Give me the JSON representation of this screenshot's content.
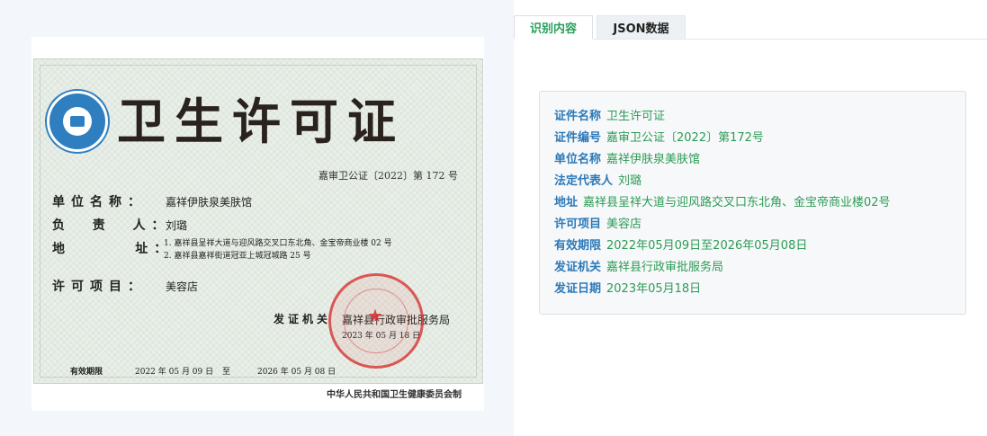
{
  "certificate_image": {
    "title": "卫生许可证",
    "number": "嘉审卫公证〔2022〕第 172 号",
    "labels": {
      "unit_name": "单位名称：",
      "responsible": "负  责  人：",
      "address": "地      址：",
      "license_items": "许可项目：",
      "issuer": "发证机关",
      "valid": "有效期限",
      "to": "至"
    },
    "values": {
      "unit_name": "嘉祥伊肤泉美肤馆",
      "responsible": "刘璐",
      "address_1": "1. 嘉祥县呈祥大道与迎风路交叉口东北角、金宝帝商业楼 02 号",
      "address_2": "2. 嘉祥县嘉祥街道冠亚上城冠城路 25 号",
      "license_items": "美容店",
      "issuer": "嘉祥县行政审批服务局",
      "issue_date": "2023 年 05 月 18 日",
      "valid_from": "2022 年 05 月 09 日",
      "valid_to": "2026 年 05 月 08 日"
    },
    "footer": "中华人民共和国卫生健康委员会制"
  },
  "tabs": {
    "active": "识别内容",
    "inactive": "JSON数据"
  },
  "result": {
    "fields": [
      {
        "label": "证件名称",
        "value": "卫生许可证"
      },
      {
        "label": "证件编号",
        "value": "嘉审卫公证〔2022〕第172号"
      },
      {
        "label": "单位名称",
        "value": "嘉祥伊肤泉美肤馆"
      },
      {
        "label": "法定代表人",
        "value": "刘璐"
      },
      {
        "label": "地址",
        "value": "嘉祥县呈祥大道与迎风路交叉口东北角、金宝帝商业楼02号"
      },
      {
        "label": "许可项目",
        "value": "美容店"
      },
      {
        "label": "有效期限",
        "value": "2022年05月09日至2026年05月08日"
      },
      {
        "label": "发证机关",
        "value": "嘉祥县行政审批服务局"
      },
      {
        "label": "发证日期",
        "value": "2023年05月18日"
      }
    ]
  },
  "colors": {
    "label": "#2c79b8",
    "value": "#2d9b55",
    "active_tab": "#27a05a"
  }
}
